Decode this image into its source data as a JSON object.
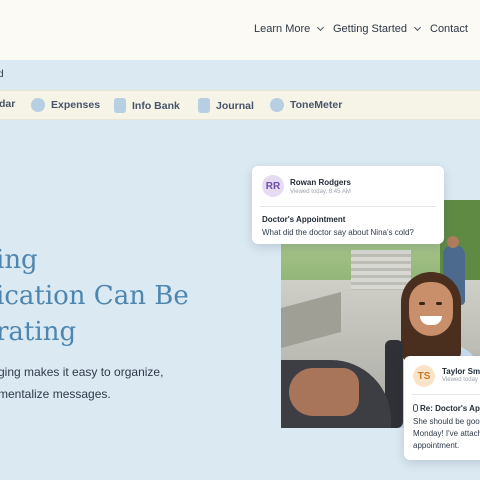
{
  "topnav": {
    "items": [
      {
        "label": "Learn More",
        "has_dropdown": true
      },
      {
        "label": "Getting Started",
        "has_dropdown": true
      },
      {
        "label": "Contact",
        "has_dropdown": false
      }
    ]
  },
  "subbar": {
    "text": "d"
  },
  "features": [
    {
      "label": "dar",
      "icon": "calendar-icon"
    },
    {
      "label": "Expenses",
      "icon": "expenses-icon"
    },
    {
      "label": "Info Bank",
      "icon": "info-bank-icon"
    },
    {
      "label": "Journal",
      "icon": "journal-icon"
    },
    {
      "label": "ToneMeter",
      "icon": "tonemeter-icon"
    }
  ],
  "hero": {
    "title_lines": [
      "ing",
      "ication Can Be",
      "rating"
    ],
    "subtitle_lines": [
      "ging makes it easy to organize,",
      "mentalize messages."
    ]
  },
  "card1": {
    "initials": "RR",
    "name": "Rowan Rodgers",
    "viewed": "Viewed today, 8:45 AM",
    "subject": "Doctor's Appointment",
    "message": "What did the doctor say about Nina's cold?"
  },
  "card2": {
    "initials": "TS",
    "name": "Taylor Smi",
    "viewed": "Viewed today",
    "subject": "Re: Doctor's Ap",
    "message_lines": [
      "She should be good",
      "Monday! I've attach",
      "appointment."
    ]
  },
  "colors": {
    "background": "#dbe9f2",
    "nav_bg": "#fbfaf5",
    "feature_bar_bg": "#f6f3e7",
    "hero_title": "#4e86b0"
  }
}
